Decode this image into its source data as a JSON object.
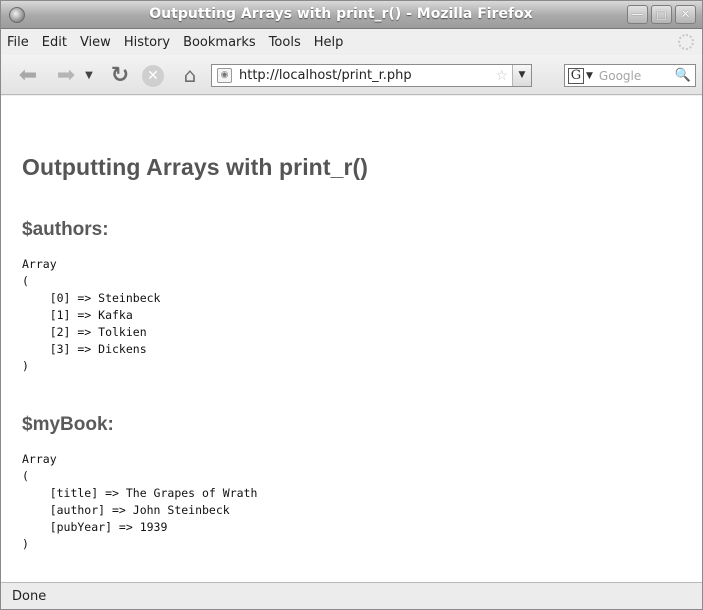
{
  "window": {
    "title": "Outputting Arrays with print_r() - Mozilla Firefox"
  },
  "menubar": {
    "items": [
      "File",
      "Edit",
      "View",
      "History",
      "Bookmarks",
      "Tools",
      "Help"
    ]
  },
  "navbar": {
    "url": "http://localhost/print_r.php",
    "search_placeholder": "Google"
  },
  "page": {
    "title": "Outputting Arrays with print_r()",
    "sections": [
      {
        "heading": "$authors:",
        "output": "Array\n(\n    [0] => Steinbeck\n    [1] => Kafka\n    [2] => Tolkien\n    [3] => Dickens\n)"
      },
      {
        "heading": "$myBook:",
        "output": "Array\n(\n    [title] => The Grapes of Wrath\n    [author] => John Steinbeck\n    [pubYear] => 1939\n)"
      }
    ]
  },
  "statusbar": {
    "text": "Done"
  }
}
